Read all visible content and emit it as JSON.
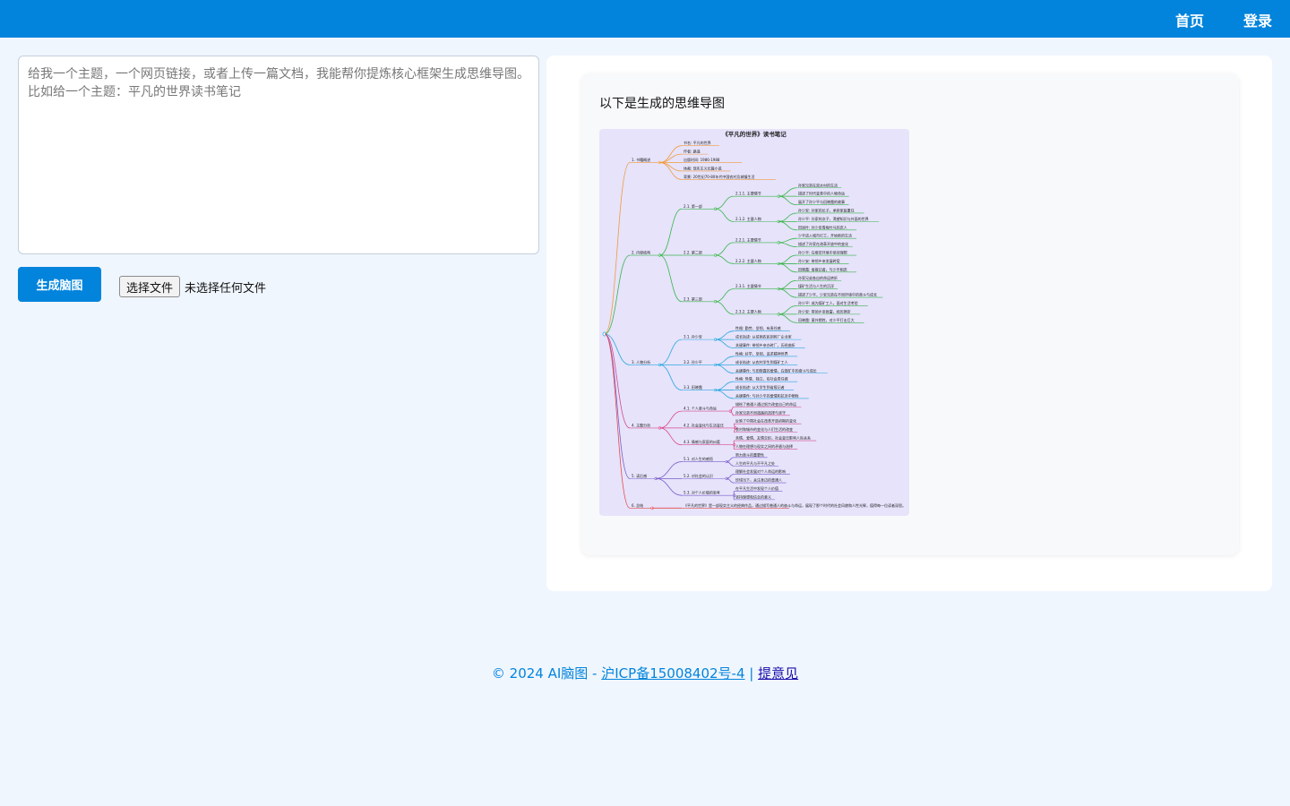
{
  "nav": {
    "home": "首页",
    "login": "登录"
  },
  "prompt": {
    "placeholder": "给我一个主题，一个网页链接，或者上传一篇文档，我能帮你提炼核心框架生成思维导图。\n比如给一个主题：平凡的世界读书笔记"
  },
  "actions": {
    "generate": "生成脑图",
    "choose_file": "选择文件",
    "no_file": "未选择任何文件"
  },
  "result": {
    "title": "以下是生成的思维导图",
    "mindmap": {
      "title": "《平凡的世界》读书笔记",
      "colors": [
        "#f29a3a",
        "#39b54a",
        "#2aa7e0",
        "#d94a8c",
        "#7a5cc9",
        "#e64b4b",
        "#20b2aa",
        "#f2c030"
      ],
      "branches": [
        {
          "label": "1. 书籍概述",
          "children": [
            "书名: 平凡的世界",
            "作者: 路遥",
            "出版时间: 1986-1988",
            "体裁: 现实主义长篇小说",
            "背景: 20世纪70-80年代中国农村及城镇生活"
          ]
        },
        {
          "label": "2. 内容结构",
          "children": [
            {
              "label": "2.1. 第一部",
              "children": [
                {
                  "label": "2.1.1. 主要情节",
                  "children": [
                    "孙家兄弟在双水村的生活",
                    "描述了时代变革中的人物命运",
                    "展开了孙少平与田晓霞的故事"
                  ]
                },
                {
                  "label": "2.1.2. 主要人物",
                  "children": [
                    "孙少安: 孙家的长子，承担家庭重任",
                    "孙少平: 孙家的次子，渴望知识与外面的世界",
                    "田润叶: 孙少安青梅竹马的恋人"
                  ]
                }
              ]
            },
            {
              "label": "2.2. 第二部",
              "children": [
                {
                  "label": "2.2.1. 主要情节",
                  "children": [
                    "少平进入城市打工，开始新的生活",
                    "描述了孙家在改革开放中的变化"
                  ]
                },
                {
                  "label": "2.2.2. 主要人物",
                  "children": [
                    "孙少平: 在艰苦环境中坚持理想",
                    "孙少安: 带领乡亲发展砖窑",
                    "田晓霞: 省报记者，与少平相恋"
                  ]
                }
              ]
            },
            {
              "label": "2.3. 第三部",
              "children": [
                {
                  "label": "2.3.1. 主要情节",
                  "children": [
                    "孙家兄弟各自的命运转折",
                    "煤矿生活与人生的沉浮",
                    "描述了少平、少安兄弟在不同环境中的奋斗与成长"
                  ]
                },
                {
                  "label": "2.3.2. 主要人物",
                  "children": [
                    "孙少平: 成为煤矿工人，面对生活考验",
                    "孙少安: 带领乡亲致富，经历挫折",
                    "田晓霞: 意外牺牲，对少平打击巨大"
                  ]
                }
              ]
            }
          ]
        },
        {
          "label": "3. 人物分析",
          "children": [
            {
              "label": "3.1. 孙少安",
              "children": [
                "性格: 勤劳、坚韧、有责任感",
                "成长轨迹: 从贫困农民到砖厂企业家",
                "关键事件: 带领乡亲办砖厂，历经曲折"
              ]
            },
            {
              "label": "3.2. 孙少平",
              "children": [
                "性格: 好学、坚韧、追求精神世界",
                "成长轨迹: 从农村学生到煤矿工人",
                "关键事件: 与田晓霞的爱情，在煤矿中的奋斗与成长"
              ]
            },
            {
              "label": "3.3. 田晓霞",
              "children": [
                "性格: 热情、独立、有社会责任感",
                "成长轨迹: 从大学生到省报记者",
                "关键事件: 与孙少平的爱情和抗洪中牺牲"
              ]
            }
          ]
        },
        {
          "label": "4. 主题分析",
          "children": [
            {
              "label": "4.1. 个人奋斗与命运",
              "children": [
                "描绘了普通人通过努力改变自己的命运",
                "孙家兄弟不同道路的选择与坚守"
              ]
            },
            {
              "label": "4.2. 社会变化与生活变迁",
              "children": [
                "反映了中国社会在改革开放初期的变化",
                "农村和城市的变化与人们生活的改变"
              ]
            },
            {
              "label": "4.3. 情感与家庭的纠葛",
              "children": [
                "亲情、爱情、友情交织，社会变迁影响人际关系",
                "人物在理想与现实之间的矛盾与选择"
              ]
            }
          ]
        },
        {
          "label": "5. 读后感",
          "children": [
            {
              "label": "5.1. 对人生的感悟",
              "children": [
                "努力奋斗的重要性",
                "人生的平凡与不平凡之处"
              ]
            },
            {
              "label": "5.2. 对社会的认识",
              "children": [
                "理解社会发展对个人命运的影响",
                "珍惜当下，关注身边的普通人"
              ]
            },
            {
              "label": "5.3. 对个人价值的思考",
              "children": [
                "在平凡生活中发现个人价值",
                "坚持理想和信念的意义"
              ]
            }
          ]
        },
        {
          "label": "6. 总结",
          "children": [
            "《平凡的世界》是一部现实主义的经典作品，通过描写普通人的奋斗与命运，展现了那个时代的社会风貌和人性光辉，值得每一位读者深思。"
          ]
        }
      ]
    }
  },
  "footer": {
    "copyright": "© 2024 AI脑图 - ",
    "icp": "沪ICP备15008402号-4",
    "separator": " | ",
    "feedback": "提意见"
  }
}
